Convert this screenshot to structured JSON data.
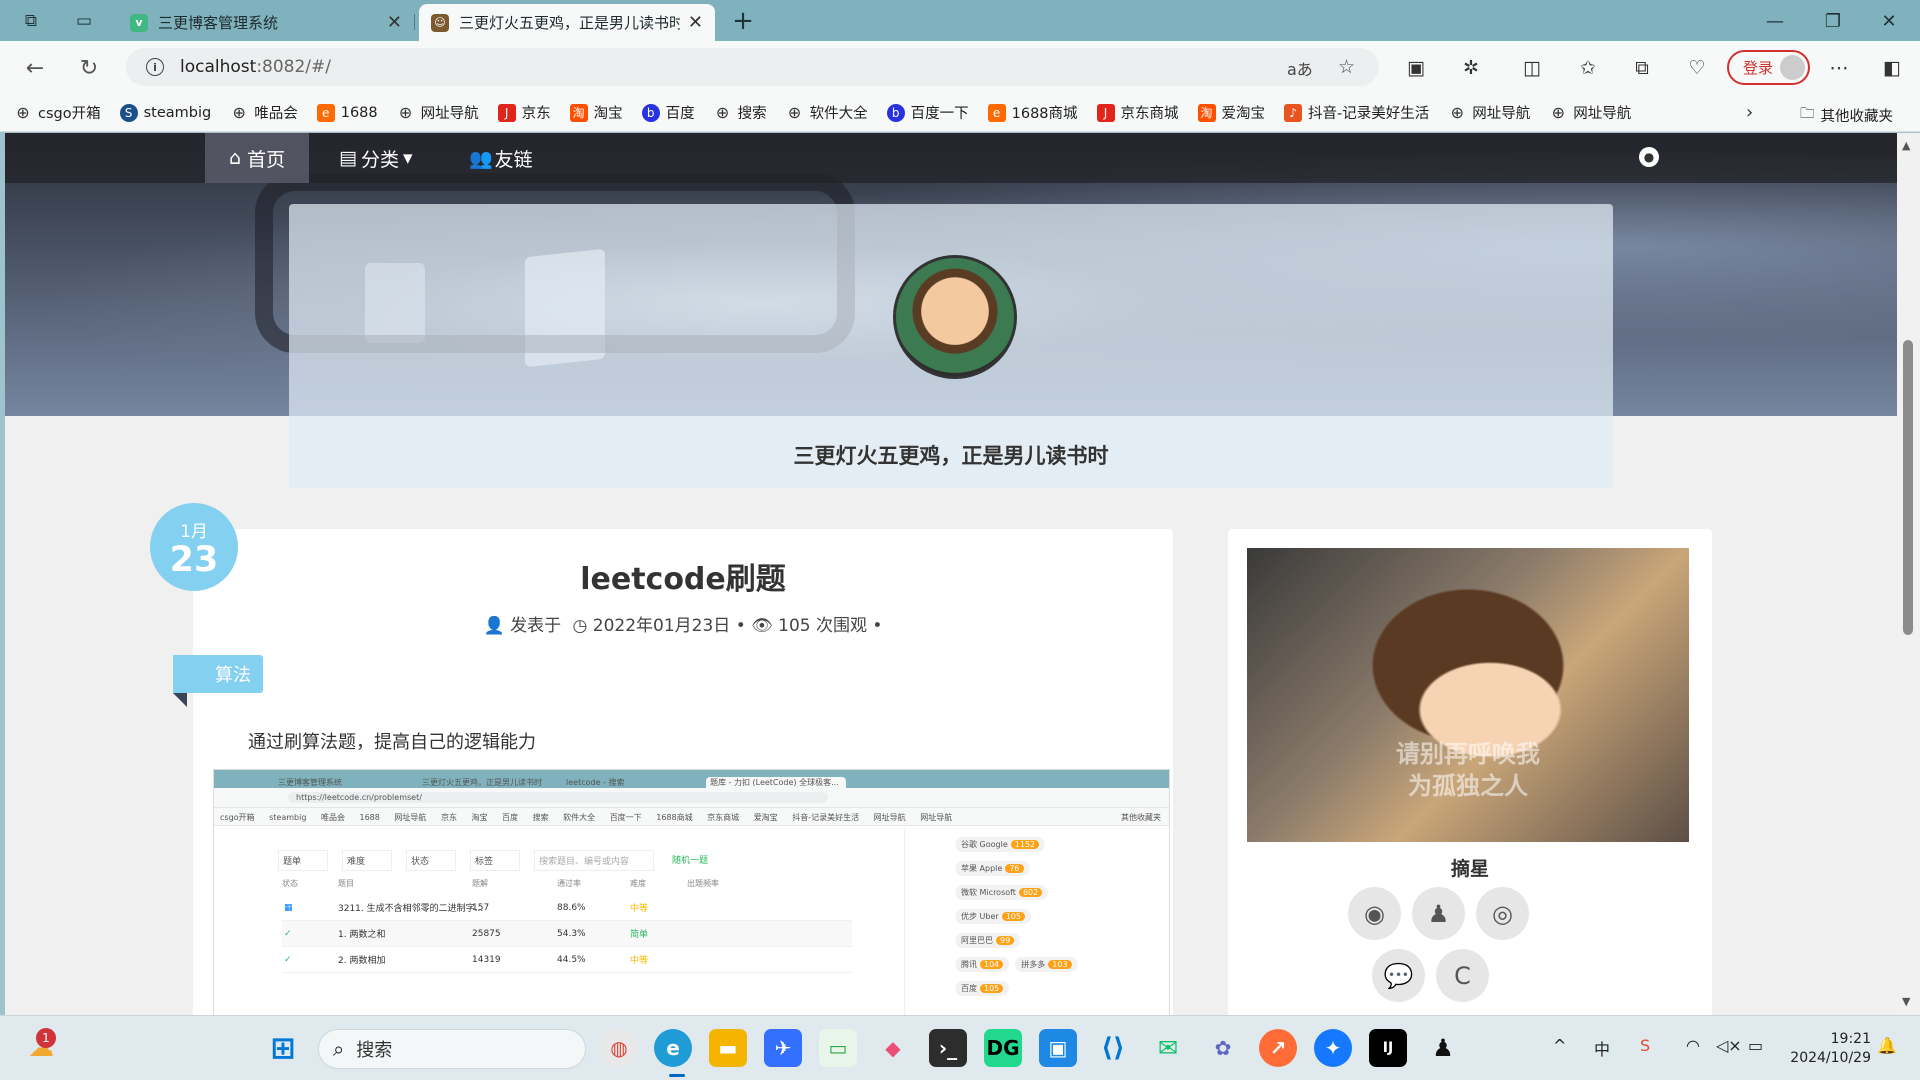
{
  "browser": {
    "tabs": [
      {
        "label": "三更博客管理系统",
        "active": false
      },
      {
        "label": "三更灯火五更鸡，正是男儿读书时",
        "active": true
      }
    ],
    "new_tab": "+",
    "url_host": "localhost",
    "url_rest": ":8082/#/",
    "login_label": "登录"
  },
  "bookmarks": [
    {
      "label": "csgo开箱",
      "icon": "globe-icon"
    },
    {
      "label": "steambig",
      "icon": "steam-icon"
    },
    {
      "label": "唯品会",
      "icon": "globe-icon"
    },
    {
      "label": "1688",
      "icon": "1688-icon"
    },
    {
      "label": "网址导航",
      "icon": "globe-icon"
    },
    {
      "label": "京东",
      "icon": "jd-icon"
    },
    {
      "label": "淘宝",
      "icon": "taobao-icon"
    },
    {
      "label": "百度",
      "icon": "baidu-icon"
    },
    {
      "label": "搜索",
      "icon": "globe-icon"
    },
    {
      "label": "软件大全",
      "icon": "globe-icon"
    },
    {
      "label": "百度一下",
      "icon": "baidu-icon"
    },
    {
      "label": "1688商城",
      "icon": "1688-icon"
    },
    {
      "label": "京东商城",
      "icon": "jd-icon"
    },
    {
      "label": "爱淘宝",
      "icon": "taobao-icon"
    },
    {
      "label": "抖音-记录美好生活",
      "icon": "douyin-icon"
    },
    {
      "label": "网址导航",
      "icon": "globe-icon"
    },
    {
      "label": "网址导航",
      "icon": "globe-icon"
    }
  ],
  "bookmarks_other": "其他收藏夹",
  "site": {
    "nav": [
      {
        "label": "首页",
        "icon": "home-icon"
      },
      {
        "label": "分类",
        "icon": "category-icon"
      },
      {
        "label": "友链",
        "icon": "users-icon"
      }
    ],
    "motto": "三更灯火五更鸡，正是男儿读书时"
  },
  "post": {
    "date_month": "1月",
    "date_day": "23",
    "title": "leetcode刷题",
    "meta_author": "发表于",
    "meta_date": "2022年01月23日",
    "meta_views": "105 次围观",
    "category": "算法",
    "excerpt": "通过刷算法题，提高自己的逻辑能力"
  },
  "screenshot_in_post": {
    "tabs": [
      "三更博客管理系统",
      "三更灯火五更鸡，正是男儿读书时",
      "leetcode - 搜索",
      "题库 - 力扣 (LeetCode) 全球极客..."
    ],
    "url": "https://leetcode.cn/problemset/",
    "bookmarks": [
      "csgo开箱",
      "steambig",
      "唯品会",
      "1688",
      "网址导航",
      "京东",
      "淘宝",
      "百度",
      "搜索",
      "软件大全",
      "百度一下",
      "1688商城",
      "京东商城",
      "爱淘宝",
      "抖音-记录美好生活",
      "网址导航",
      "网址导航"
    ],
    "bookmarks_other": "其他收藏夹",
    "filters": [
      "题单",
      "难度",
      "状态",
      "标签"
    ],
    "search_placeholder": "搜索题目、编号或内容",
    "random": "随机一题",
    "headers": [
      "状态",
      "题目",
      "题解",
      "通过率",
      "难度",
      "出题频率"
    ],
    "rows": [
      {
        "title": "3211. 生成不含相邻零的二进制字...",
        "solutions": "157",
        "rate": "88.6%",
        "difficulty": "中等"
      },
      {
        "title": "1. 两数之和",
        "solutions": "25875",
        "rate": "54.3%",
        "difficulty": "简单"
      },
      {
        "title": "2. 两数相加",
        "solutions": "14319",
        "rate": "44.5%",
        "difficulty": "中等"
      }
    ],
    "companies": [
      {
        "name": "谷歌 Google",
        "count": "1152"
      },
      {
        "name": "苹果 Apple",
        "count": "76"
      },
      {
        "name": "微软 Microsoft",
        "count": "602"
      },
      {
        "name": "优步 Uber",
        "count": "105"
      },
      {
        "name": "阿里巴巴",
        "count": "99"
      },
      {
        "name": "腾讯",
        "count": "104"
      },
      {
        "name": "拼多多",
        "count": "103"
      },
      {
        "name": "百度",
        "count": "105"
      }
    ]
  },
  "sidebar": {
    "image_caption_1": "请别再呼唤我",
    "image_caption_2": "为孤独之人",
    "author": "摘星",
    "socials": [
      "github-icon",
      "qq-icon",
      "weibo-icon",
      "wechat-icon",
      "csdn-icon"
    ],
    "csdn_letter": "C"
  },
  "taskbar": {
    "search_label": "搜索",
    "weather_badge": "1",
    "time": "19:21",
    "date": "2024/10/29",
    "ime": "中"
  }
}
